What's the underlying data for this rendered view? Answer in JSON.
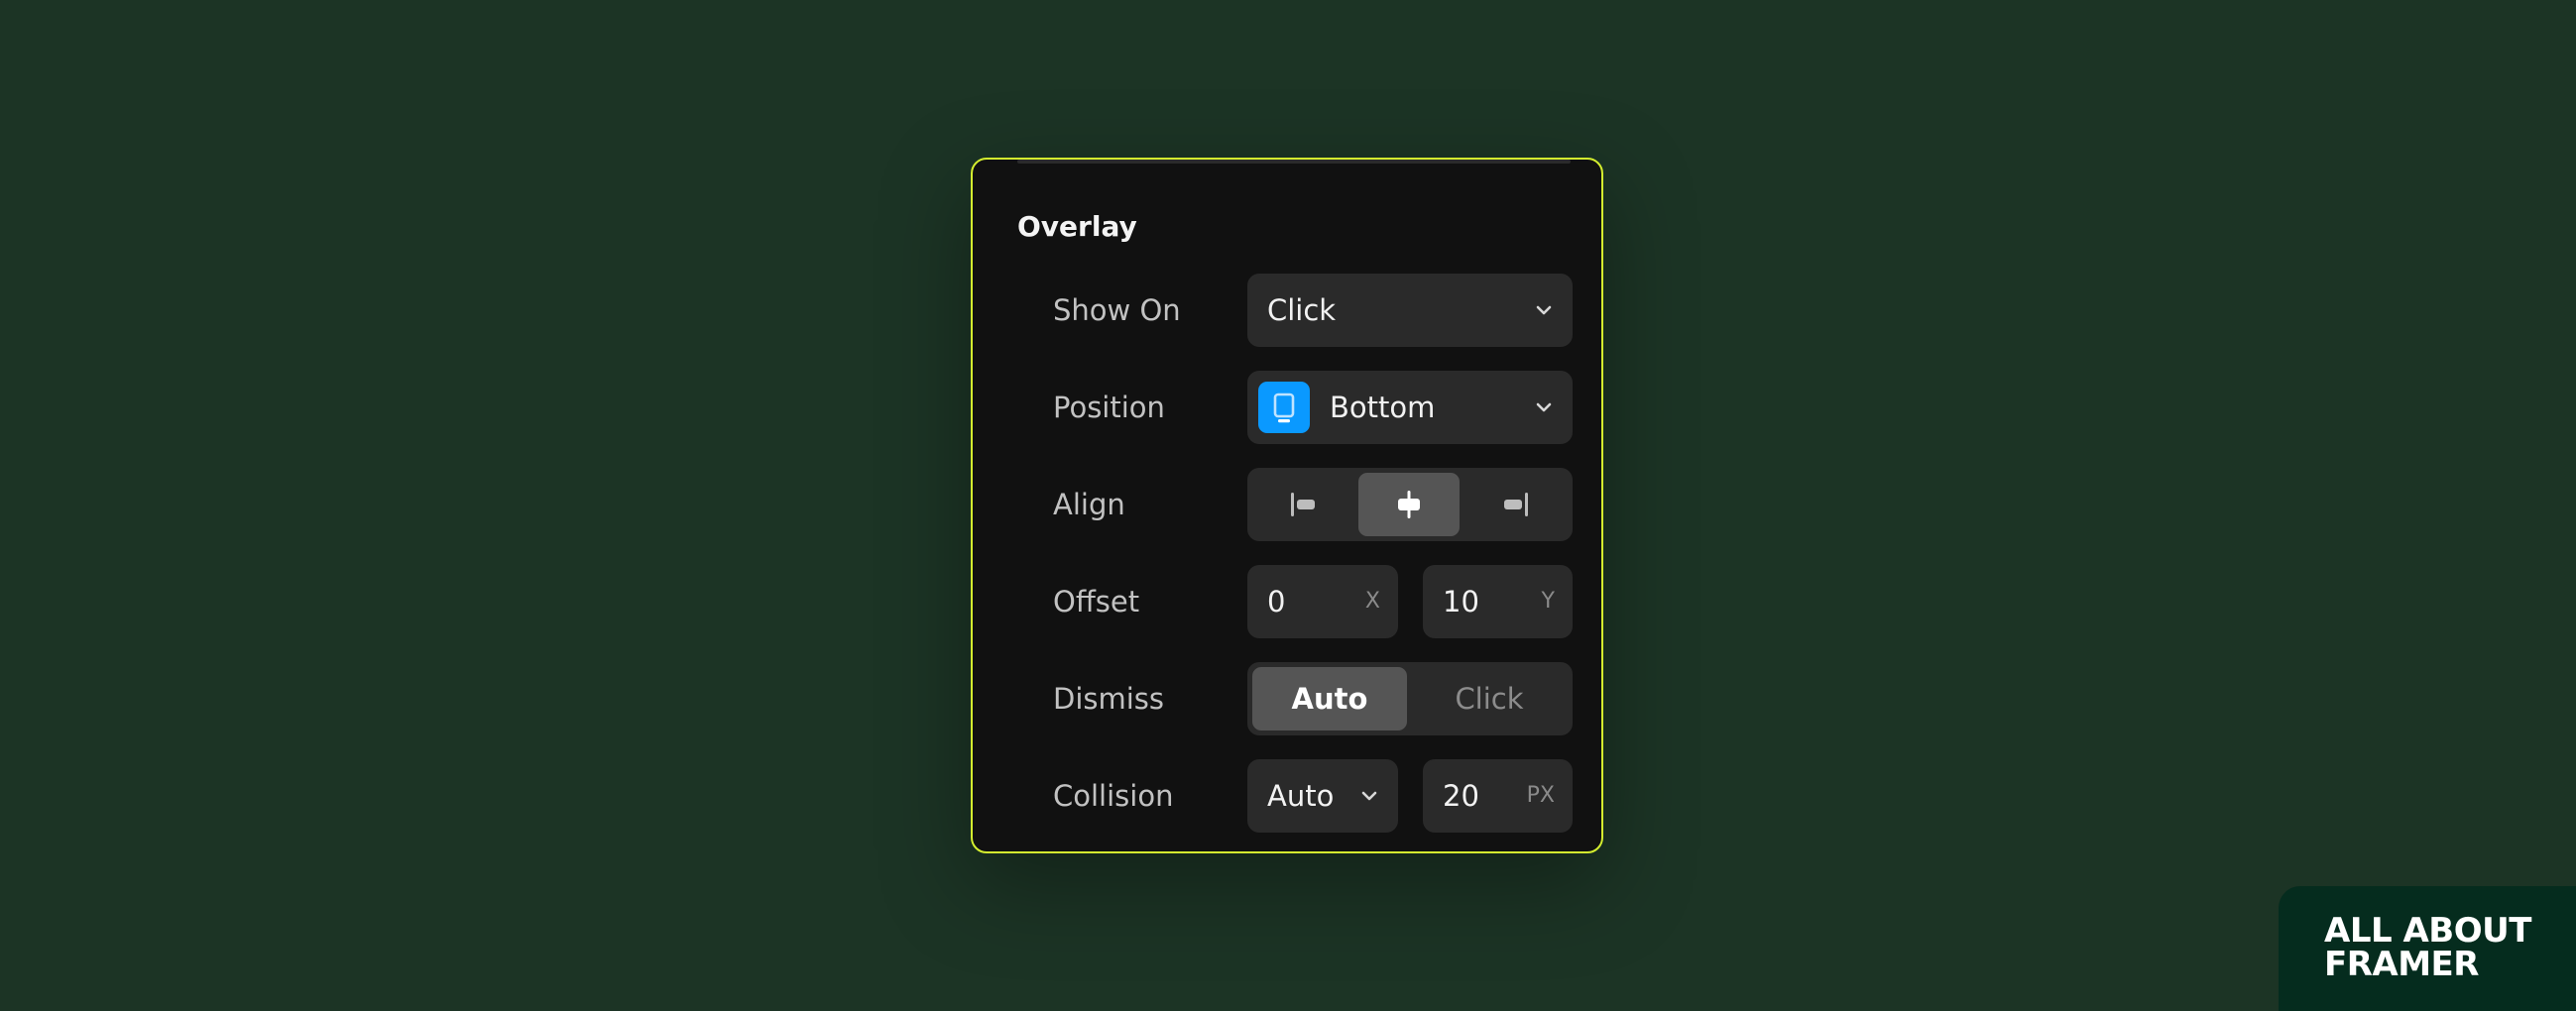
{
  "panel": {
    "section_title": "Overlay",
    "rows": {
      "show_on": {
        "label": "Show On",
        "value": "Click"
      },
      "position": {
        "label": "Position",
        "value": "Bottom",
        "icon": "position-bottom-icon",
        "icon_color": "#0a99ff"
      },
      "align": {
        "label": "Align",
        "options": [
          "align-start-icon",
          "align-center-icon",
          "align-end-icon"
        ],
        "selected": "align-center-icon"
      },
      "offset": {
        "label": "Offset",
        "x_value": "0",
        "x_suffix": "X",
        "y_value": "10",
        "y_suffix": "Y"
      },
      "dismiss": {
        "label": "Dismiss",
        "options": [
          "Auto",
          "Click"
        ],
        "selected": "Auto"
      },
      "collision": {
        "label": "Collision",
        "mode": "Auto",
        "padding_value": "20",
        "padding_suffix": "PX"
      }
    }
  },
  "brand": {
    "line1": "ALL ABOUT",
    "line2": "FRAMER"
  },
  "colors": {
    "background": "#1c3425",
    "panel": "#111111",
    "panel_border": "#d4ee2f",
    "control": "#2a2a2a",
    "active_segment": "#555555",
    "brand_badge": "#052c1e"
  }
}
